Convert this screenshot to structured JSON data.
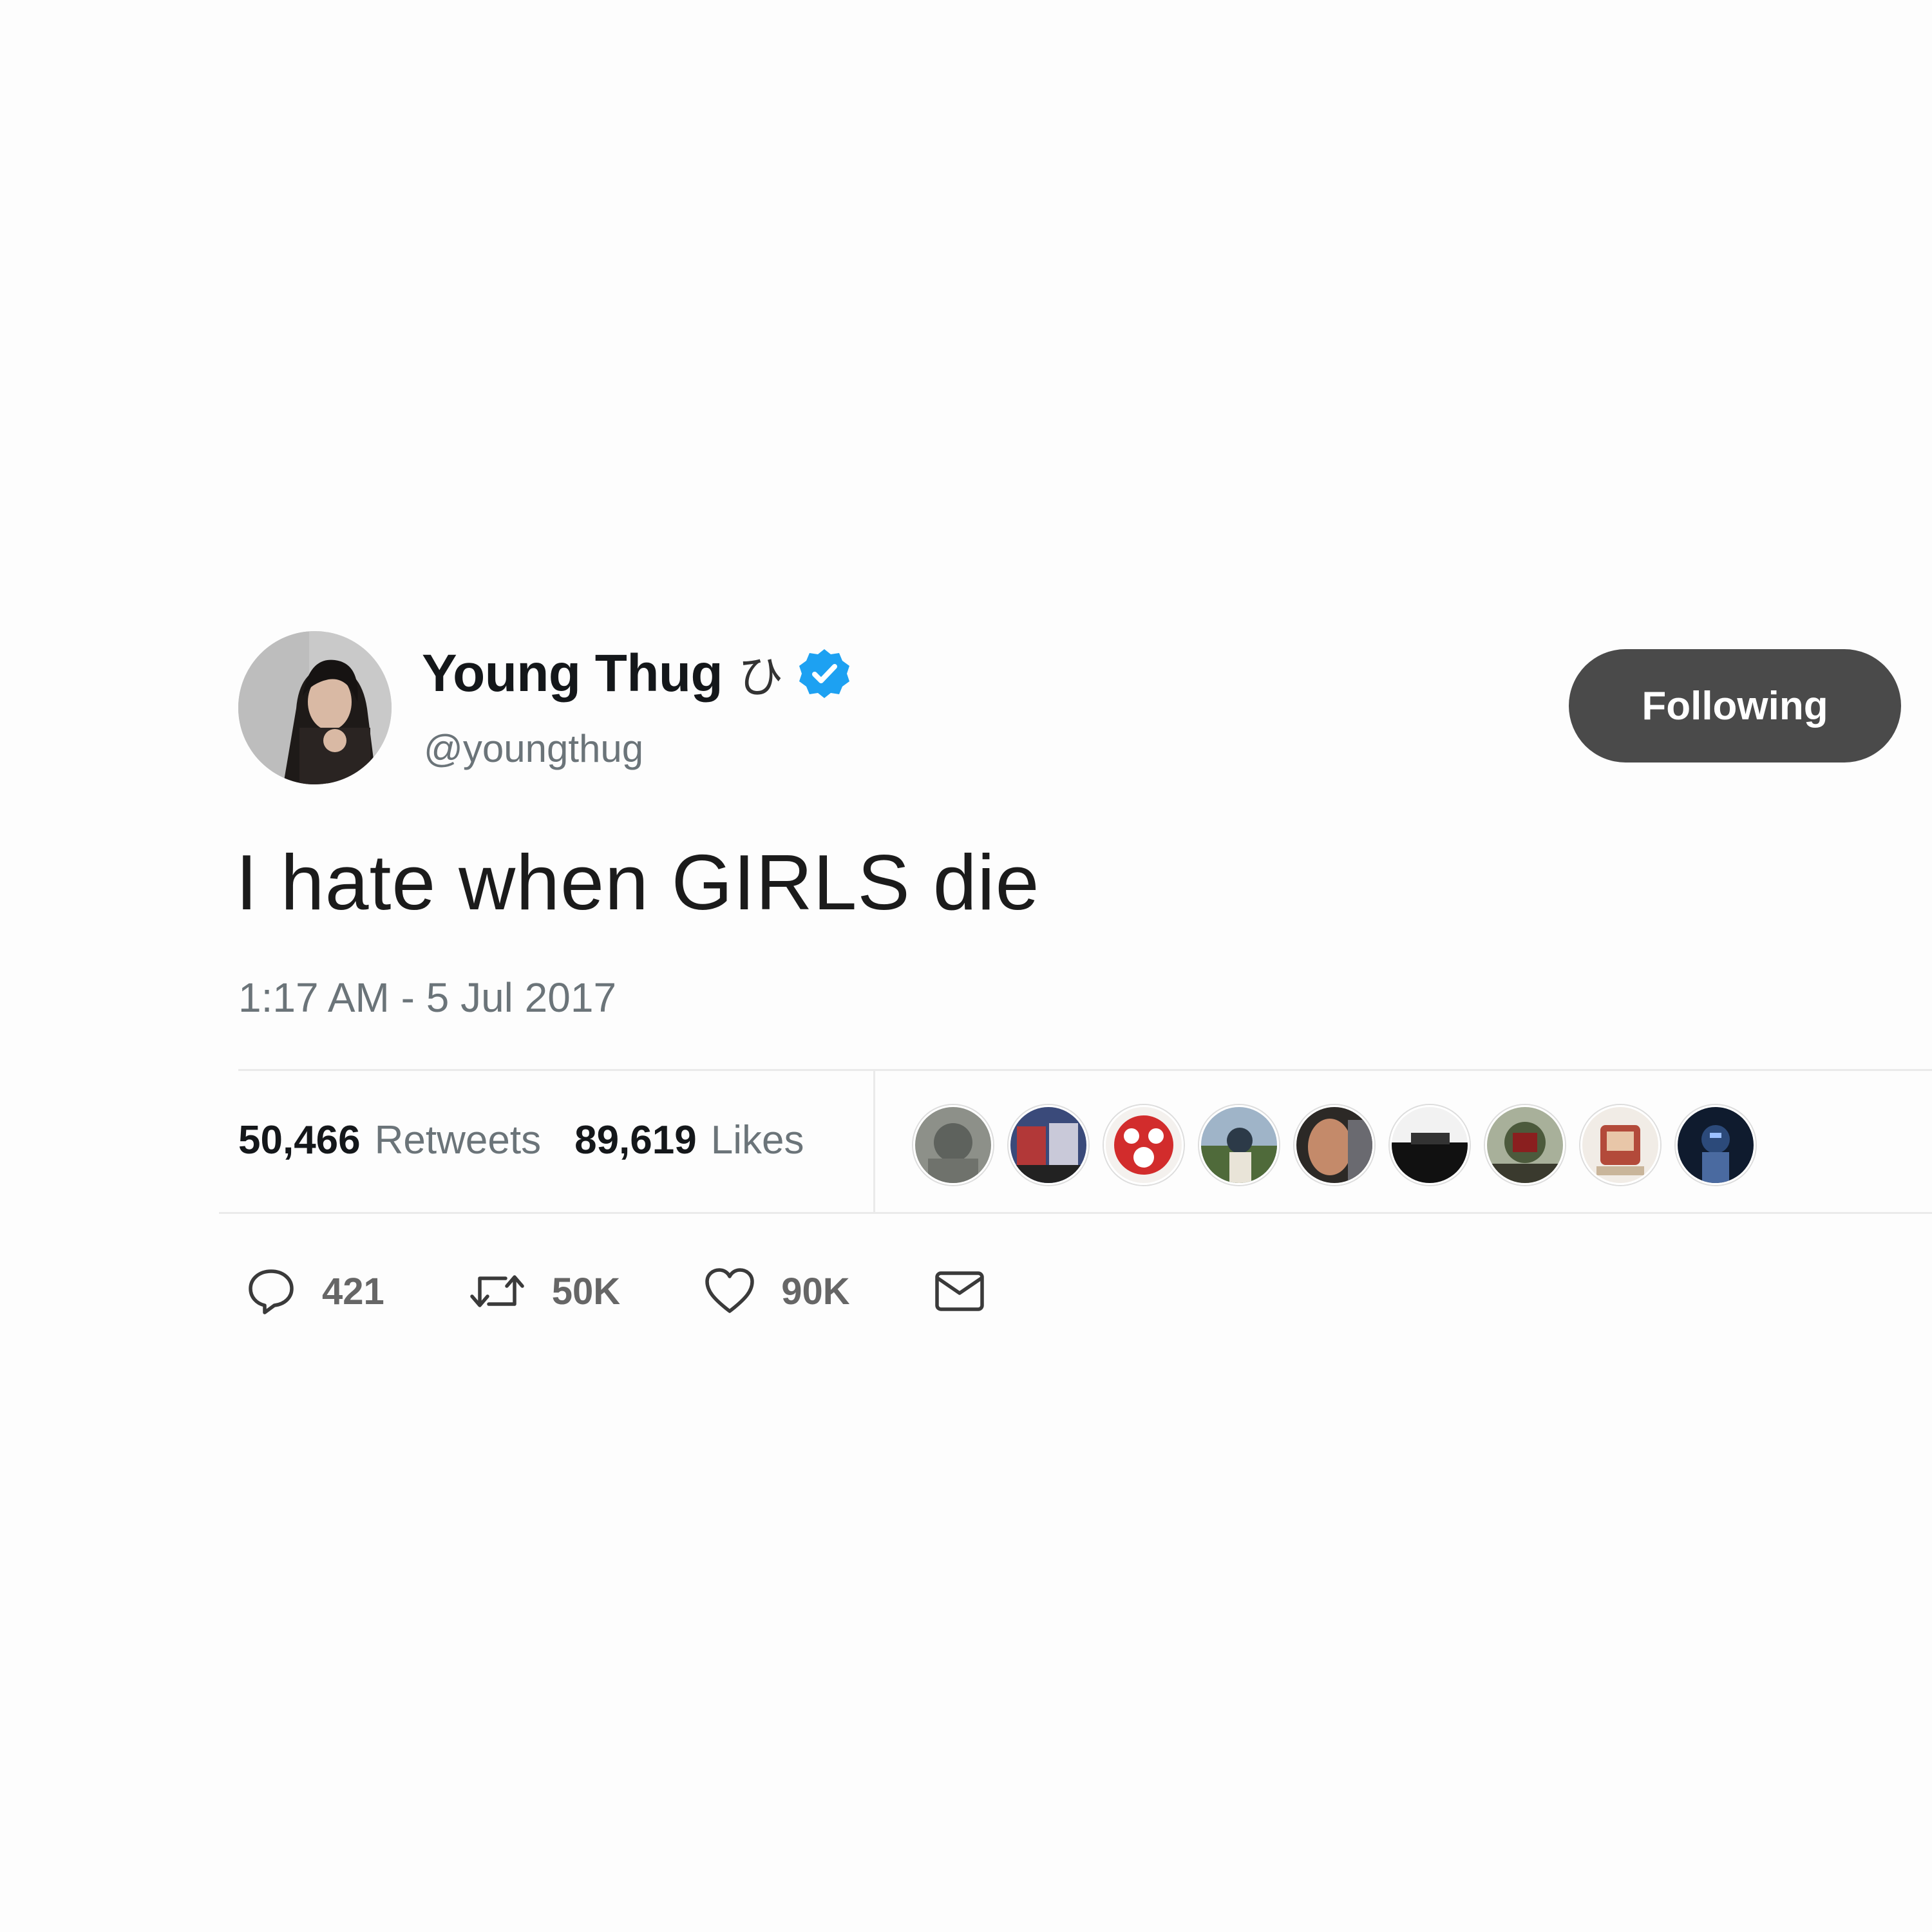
{
  "tweet": {
    "author": {
      "display_name": "Young Thug",
      "name_glyph": "ひ",
      "handle": "@youngthug",
      "verified": true
    },
    "follow_button_label": "Following",
    "text": "I hate when GIRLS die",
    "timestamp": "1:17 AM - 5 Jul 2017",
    "stats": {
      "retweets_count": "50,466",
      "retweets_label": "Retweets",
      "likes_count": "89,619",
      "likes_label": "Likes"
    },
    "liker_avatars": 9,
    "actions": {
      "reply_count": "421",
      "retweet_count": "50K",
      "like_count": "90K"
    }
  },
  "colors": {
    "verified_blue": "#1da1f2",
    "follow_button_bg": "#4a4a4a",
    "secondary_text": "#6b7479"
  },
  "icons": [
    "verified-badge-icon",
    "reply-icon",
    "retweet-icon",
    "heart-icon",
    "envelope-icon"
  ]
}
